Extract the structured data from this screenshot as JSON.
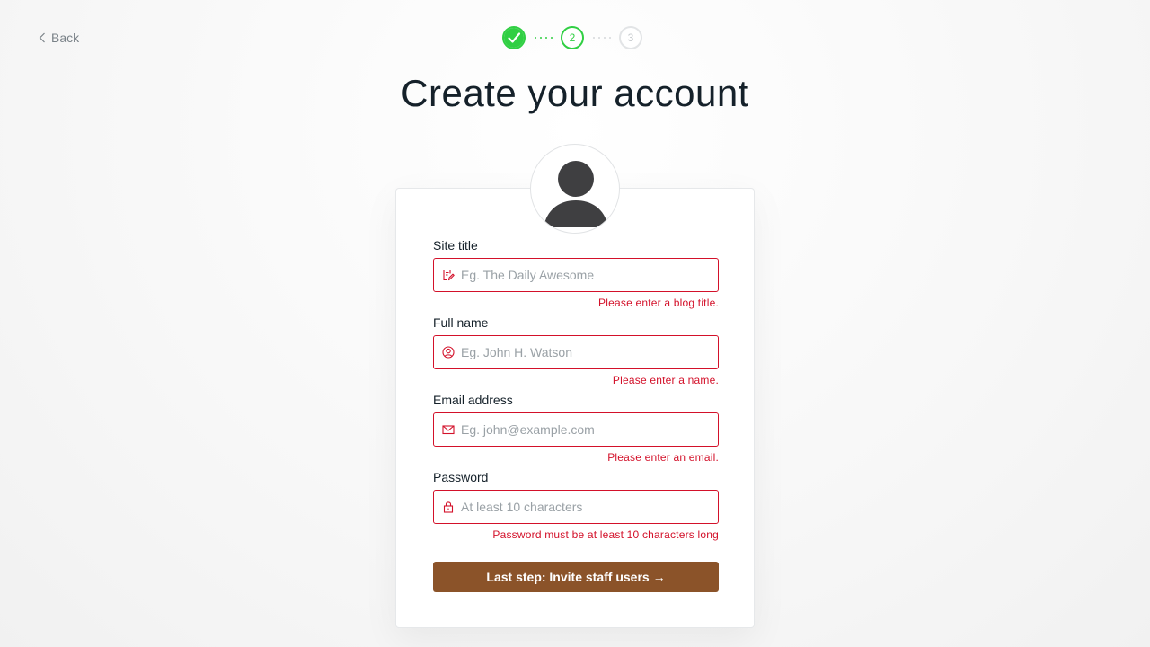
{
  "nav": {
    "back_label": "Back"
  },
  "progress": {
    "steps": [
      {
        "label": "1",
        "state": "complete"
      },
      {
        "label": "2",
        "state": "current"
      },
      {
        "label": "3",
        "state": "upcoming"
      }
    ]
  },
  "page": {
    "title": "Create your account"
  },
  "form": {
    "fields": [
      {
        "label": "Site title",
        "placeholder": "Eg. The Daily Awesome",
        "value": "",
        "error": "Please enter a blog title.",
        "icon": "pencil-note-icon"
      },
      {
        "label": "Full name",
        "placeholder": "Eg. John H. Watson",
        "value": "",
        "error": "Please enter a name.",
        "icon": "user-circle-icon"
      },
      {
        "label": "Email address",
        "placeholder": "Eg. john@example.com",
        "value": "",
        "error": "Please enter an email.",
        "icon": "envelope-icon"
      },
      {
        "label": "Password",
        "placeholder": "At least 10 characters",
        "value": "",
        "error": "Password must be at least 10 characters long",
        "icon": "lock-icon"
      }
    ],
    "submit_label": "Last step: Invite staff users →"
  },
  "colors": {
    "accent_green": "#30cf43",
    "error_red": "#d3112a",
    "button_brown": "#8b5329"
  }
}
